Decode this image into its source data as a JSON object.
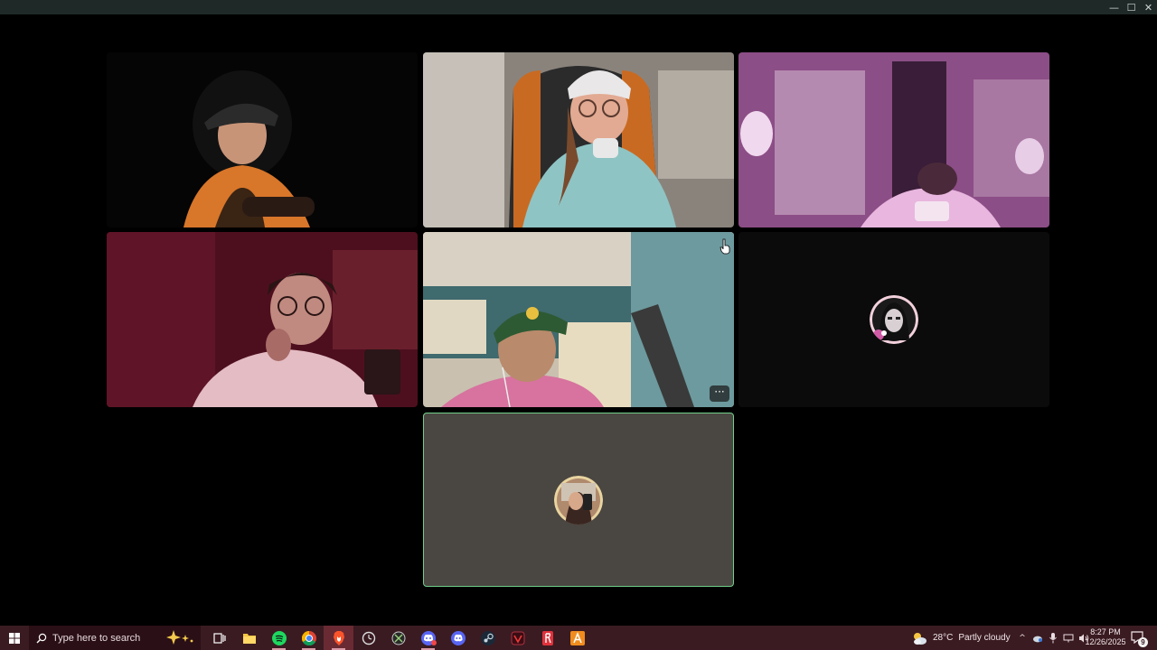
{
  "window": {
    "controls": {
      "minimize": "—",
      "maximize": "☐",
      "close": "✕"
    }
  },
  "call": {
    "participants": [
      {
        "tile": 1,
        "type": "video",
        "scene": "man in cap and orange hoodie, dark room"
      },
      {
        "tile": 2,
        "type": "video",
        "scene": "woman in white beanie and glasses, gaming chair"
      },
      {
        "tile": 3,
        "type": "video",
        "scene": "purple tinted blurry room"
      },
      {
        "tile": 4,
        "type": "video",
        "scene": "man with glasses in red lighting"
      },
      {
        "tile": 5,
        "type": "video",
        "scene": "man in green cap smiling, room",
        "more_label": "···"
      },
      {
        "tile": 6,
        "type": "avatar",
        "scene": "dark tile with avatar"
      },
      {
        "tile": 7,
        "type": "avatar",
        "scene": "grey tile with avatar, speaking highlight"
      }
    ],
    "speaking_border_color": "#6fd08a"
  },
  "taskbar": {
    "search_placeholder": "Type here to search",
    "apps": [
      "task-view",
      "file-explorer",
      "spotify",
      "chrome",
      "brave",
      "app-clock",
      "app-xbox",
      "discord-canary",
      "discord",
      "steam",
      "vivaldi",
      "app-red",
      "app-a"
    ],
    "weather": {
      "temp": "28°C",
      "condition": "Partly cloudy"
    },
    "clock": {
      "time": "8:27 PM",
      "date": "12/26/2025"
    },
    "notifications": "9"
  },
  "colors": {
    "taskbar": "#3a1b22",
    "titlebar": "#1f2a28"
  }
}
